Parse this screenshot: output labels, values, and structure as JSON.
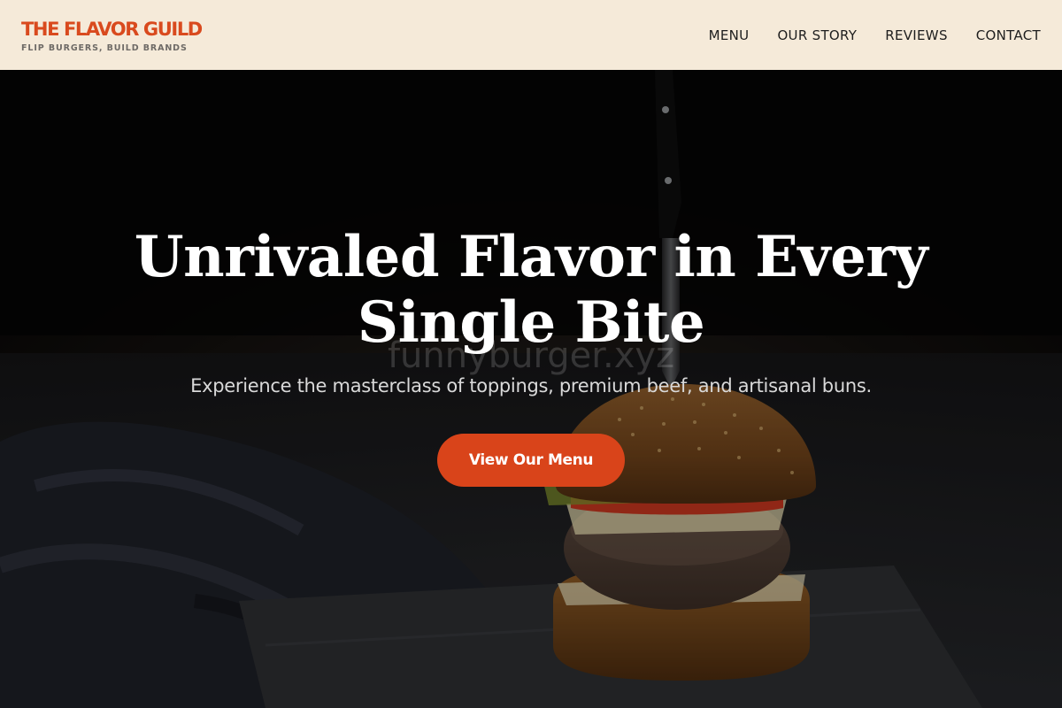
{
  "brand": {
    "name": "THE FLAVOR GUILD",
    "tagline": "FLIP BURGERS, BUILD BRANDS"
  },
  "nav": {
    "items": [
      {
        "label": "MENU"
      },
      {
        "label": "OUR STORY"
      },
      {
        "label": "REVIEWS"
      },
      {
        "label": "CONTACT"
      }
    ]
  },
  "hero": {
    "title_line1": "Unrivaled Flavor in Every",
    "title_line2": "Single Bite",
    "watermark": "funnyburger.xyz",
    "subtitle": "Experience the masterclass of toppings, premium beef, and artisanal buns.",
    "cta_label": "View Our Menu"
  },
  "colors": {
    "brand_orange": "#d94a1e",
    "tagline_gray": "#6e6a66",
    "header_bg": "#f5ead9",
    "cta_bg": "#d9441a"
  }
}
